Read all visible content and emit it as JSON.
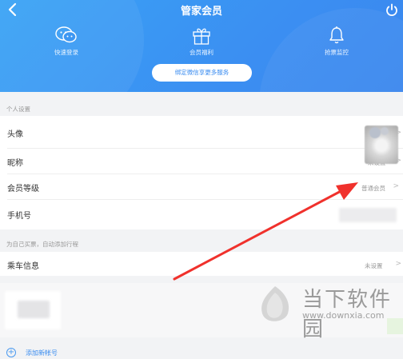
{
  "header": {
    "title": "管家会员",
    "features": [
      {
        "label": "快速登录",
        "icon": "wechat-icon"
      },
      {
        "label": "会员福利",
        "icon": "gift-icon"
      },
      {
        "label": "抢票监控",
        "icon": "bell-icon"
      }
    ],
    "bind_button": "绑定微信享更多服务",
    "accent_color": "#3b8ff2"
  },
  "personal": {
    "section_title": "个人设置",
    "rows": [
      {
        "label": "头像",
        "value": ""
      },
      {
        "label": "昵称",
        "value": "未设置"
      },
      {
        "label": "会员等级",
        "value": "普通会员"
      },
      {
        "label": "手机号",
        "value": ""
      }
    ]
  },
  "travel": {
    "section_title": "为自己买票，自动添加行程",
    "rows": [
      {
        "label": "乘车信息",
        "value": "未设置"
      }
    ]
  },
  "account": {
    "add_label": "添加新帐号"
  },
  "watermark": {
    "brand": "当下软件园",
    "url": "www.downxia.com"
  },
  "annotation": {
    "color": "#f0312c"
  }
}
